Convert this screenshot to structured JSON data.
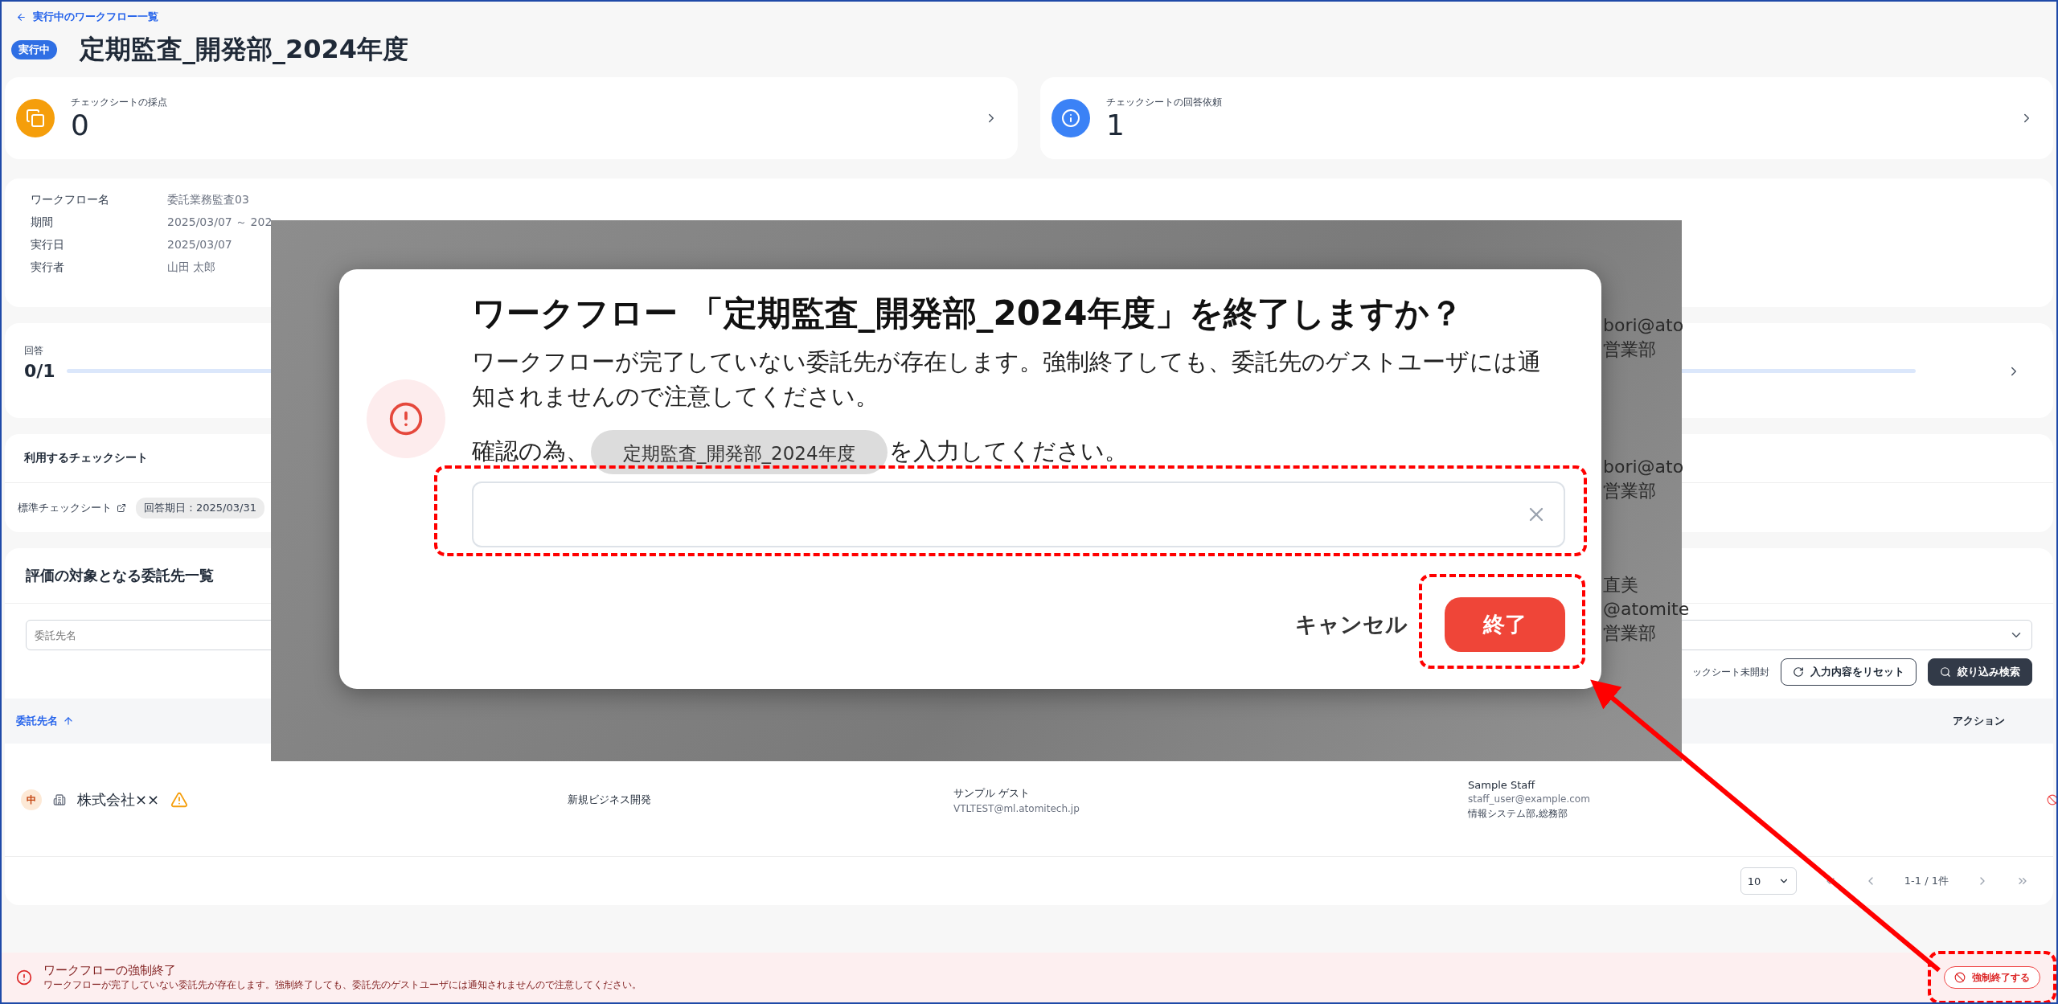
{
  "back_link": "実行中のワークフロー一覧",
  "status_badge": "実行中",
  "title": "定期監査_開発部_2024年度",
  "stats": [
    {
      "kind": "scoring",
      "label": "チェックシートの採点",
      "value": "0",
      "color": "#f59e0b"
    },
    {
      "kind": "request",
      "label": "チェックシートの回答依頼",
      "value": "1",
      "color": "#3b82f6"
    }
  ],
  "workflow_info": [
    {
      "label": "ワークフロー名",
      "value": "委託業務監査03"
    },
    {
      "label": "期間",
      "value": "2025/03/07 ～ 202"
    },
    {
      "label": "実行日",
      "value": "2025/03/07"
    },
    {
      "label": "実行者",
      "value": "山田 太郎"
    }
  ],
  "answers": {
    "label": "回答",
    "count": "0/1",
    "level": 0
  },
  "checksheet": {
    "heading": "利用するチェックシート",
    "name": "標準チェックシート",
    "due": "回答期日：2025/03/31"
  },
  "entrustees": {
    "heading": "評価の対象となる委託先一覧",
    "search": {
      "placeholder": "委託先名"
    },
    "filter_option": "ックシート未開封",
    "reset_button": "入力内容をリセット",
    "search_button": "絞り込み検索",
    "columns": [
      {
        "label": "委託先名",
        "sorted": true
      },
      {
        "label": "アクション",
        "sorted": false
      }
    ],
    "rows": [
      {
        "risk": "中",
        "name": "株式会社××",
        "warning": true,
        "business": "新規ビジネス開発",
        "guest_name": "サンプル ゲスト",
        "guest_email": "VTLTEST@ml.atomitech.jp",
        "staff_name": "Sample Staff",
        "staff_email": "staff_user@example.com",
        "staff_dept": "情報システム部,総務部"
      }
    ],
    "pagination": {
      "page_size": "10",
      "range": "1-1 / 1件"
    }
  },
  "background_rows": [
    {
      "email": "bori@ato",
      "dept": "営業部"
    },
    {
      "email": "bori@ato",
      "dept": "営業部"
    },
    {
      "name": "直美",
      "email": "@atomite",
      "dept": "営業部"
    }
  ],
  "alert": {
    "title": "ワークフローの強制終了",
    "message": "ワークフローが完了していない委託先が存在します。強制終了しても、委託先のゲストユーザには通知されませんので注意してください。",
    "button": "強制終了する"
  },
  "dialog": {
    "title": "ワークフロー 「定期監査_開発部_2024年度」を終了しますか？",
    "message": "ワークフローが完了していない委託先が存在します。強制終了しても、委託先のゲストユーザには通知されませんので注意してください。",
    "confirm_prefix": "確認の為、",
    "confirm_chip": "定期監査_開発部_2024年度",
    "confirm_suffix": "を入力してください。",
    "cancel_button": "キャンセル",
    "ok_button": "終了"
  }
}
